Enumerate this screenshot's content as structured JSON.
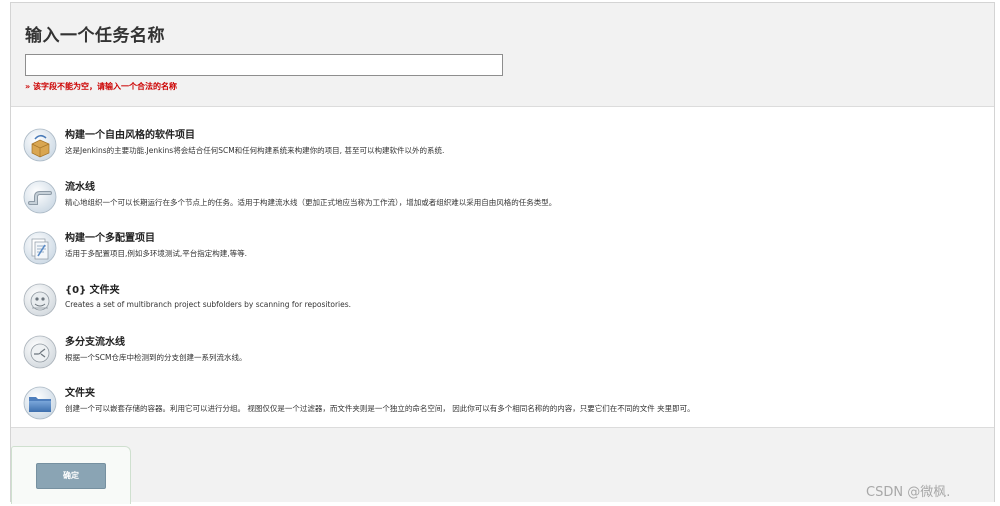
{
  "header": {
    "title": "输入一个任务名称",
    "input_value": "",
    "input_placeholder": "",
    "error": "» 该字段不能为空，请输入一个合法的名称"
  },
  "items": [
    {
      "name": "构建一个自由风格的软件项目",
      "desc": "这是Jenkins的主要功能.Jenkins将会结合任何SCM和任何构建系统来构建你的项目, 甚至可以构建软件以外的系统.",
      "icon": "freestyle-project-icon"
    },
    {
      "name": "流水线",
      "desc": "精心地组织一个可以长期运行在多个节点上的任务。适用于构建流水线（更加正式地应当称为工作流），增加或者组织难以采用自由风格的任务类型。",
      "icon": "pipeline-icon"
    },
    {
      "name": "构建一个多配置项目",
      "desc": "适用于多配置项目,例如多环境测试,平台指定构建,等等.",
      "icon": "multi-configuration-icon"
    },
    {
      "name": "{0} 文件夹",
      "desc": "Creates a set of multibranch project subfolders by scanning for repositories.",
      "icon": "organization-folder-icon"
    },
    {
      "name": "多分支流水线",
      "desc": "根据一个SCM仓库中检测到的分支创建一系列流水线。",
      "icon": "multibranch-pipeline-icon"
    },
    {
      "name": "文件夹",
      "desc": "创建一个可以嵌套存储的容器。利用它可以进行分组。 视图仅仅是一个过滤器，而文件夹则是一个独立的命名空间， 因此你可以有多个相同名称的的内容，只要它们在不同的文件 夹里即可。",
      "icon": "folder-icon"
    }
  ],
  "footer": {
    "ok_label": "确定"
  },
  "watermark": "CSDN @微枫."
}
